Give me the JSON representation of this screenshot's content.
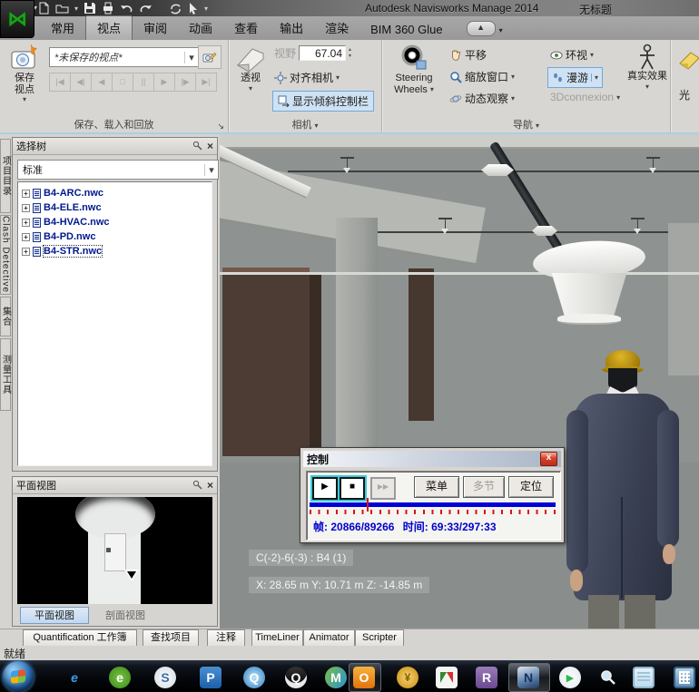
{
  "window": {
    "app_title": "Autodesk Navisworks Manage 2014",
    "doc_title": "无标题"
  },
  "ribbon_tabs": [
    "常用",
    "视点",
    "审阅",
    "动画",
    "查看",
    "输出",
    "渲染",
    "BIM 360 Glue"
  ],
  "active_tab": "视点",
  "groups": {
    "save_load": {
      "label": "保存、载入和回放",
      "save_viewpoint_1": "保存",
      "save_viewpoint_2": "视点",
      "viewpoint_name": "*未保存的视点*",
      "playback_glyphs": [
        "|◀",
        "◀|",
        "◀",
        "□",
        "||",
        "▶",
        "|▶",
        "▶|"
      ]
    },
    "camera": {
      "label": "相机",
      "perspective": "透视",
      "fov_label": "视野",
      "fov_value": "67.04",
      "align": "对齐相机",
      "tilt_bar": "显示倾斜控制栏"
    },
    "nav": {
      "label": "导航",
      "steering_1": "Steering",
      "steering_2": "Wheels",
      "pan": "平移",
      "zoom_window": "缩放窗口",
      "orbit": "动态观察",
      "look": "环视",
      "walk": "漫游",
      "conn": "3Dconnexion",
      "realism": "真实效果"
    },
    "partial": {
      "label": "光"
    }
  },
  "side_tabs": [
    "项目目录",
    "Clash Detective",
    "集合",
    "测量工具"
  ],
  "selection_tree": {
    "title": "选择树",
    "filter": "标准",
    "items": [
      "B4-ARC.nwc",
      "B4-ELE.nwc",
      "B4-HVAC.nwc",
      "B4-PD.nwc",
      "B4-STR.nwc"
    ]
  },
  "plan_view": {
    "title": "平面视图",
    "tab_plan": "平面视图",
    "tab_section": "剖面视图"
  },
  "control": {
    "title": "控制",
    "play": "▶",
    "stop": "■",
    "skip": "▶▶",
    "menu": "菜单",
    "multi": "多节",
    "locate": "定位",
    "frame_label": "帧:",
    "frame": "20866/89266",
    "time_label": "时间:",
    "time": "69:33/297:33",
    "progress_fraction": 0.234
  },
  "overlays": {
    "selection": "C(-2)-6(-3) : B4 (1)",
    "coords": "X: 28.65 m  Y: 10.71 m  Z: -14.85 m"
  },
  "doc_tabs": [
    "Quantification 工作簿",
    "查找项目",
    "注释",
    "TimeLiner",
    "Animator",
    "Scripter"
  ],
  "status": "就绪",
  "taskbar_glyphs": {
    "ie": "e",
    "g360": "e",
    "sogou": "S",
    "pptv": "P",
    "qqplayer": "Q",
    "qq": "Q",
    "wlm": "M",
    "office": "O",
    "gold": "¥",
    "revit": "R",
    "navis": "N",
    "video": "▶"
  },
  "colors": {
    "ribbon_highlight_fill": "#cfe2f3",
    "ribbon_highlight_border": "#71a8d8",
    "progress_blue": "#0000d4",
    "tick_red": "#e01010",
    "tree_text": "#001a8c",
    "hardhat_gold": "#c9990f",
    "coat_navy": "#3f465a",
    "scene_gray": "#8e9391",
    "wall_brown": "#4c3c33"
  }
}
